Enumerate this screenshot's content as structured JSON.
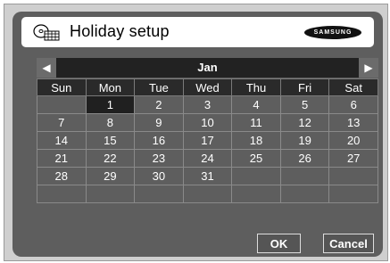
{
  "title": "Holiday setup",
  "brand": "SAMSUNG",
  "month": "Jan",
  "prev_arrow": "◀",
  "next_arrow": "▶",
  "weekdays": [
    "Sun",
    "Mon",
    "Tue",
    "Wed",
    "Thu",
    "Fri",
    "Sat"
  ],
  "weeks": [
    [
      "",
      "1",
      "2",
      "3",
      "4",
      "5",
      "6"
    ],
    [
      "7",
      "8",
      "9",
      "10",
      "11",
      "12",
      "13"
    ],
    [
      "14",
      "15",
      "16",
      "17",
      "18",
      "19",
      "20"
    ],
    [
      "21",
      "22",
      "23",
      "24",
      "25",
      "26",
      "27"
    ],
    [
      "28",
      "29",
      "30",
      "31",
      "",
      "",
      ""
    ],
    [
      "",
      "",
      "",
      "",
      "",
      "",
      ""
    ]
  ],
  "selected_day": "1",
  "buttons": {
    "ok": "OK",
    "cancel": "Cancel"
  }
}
